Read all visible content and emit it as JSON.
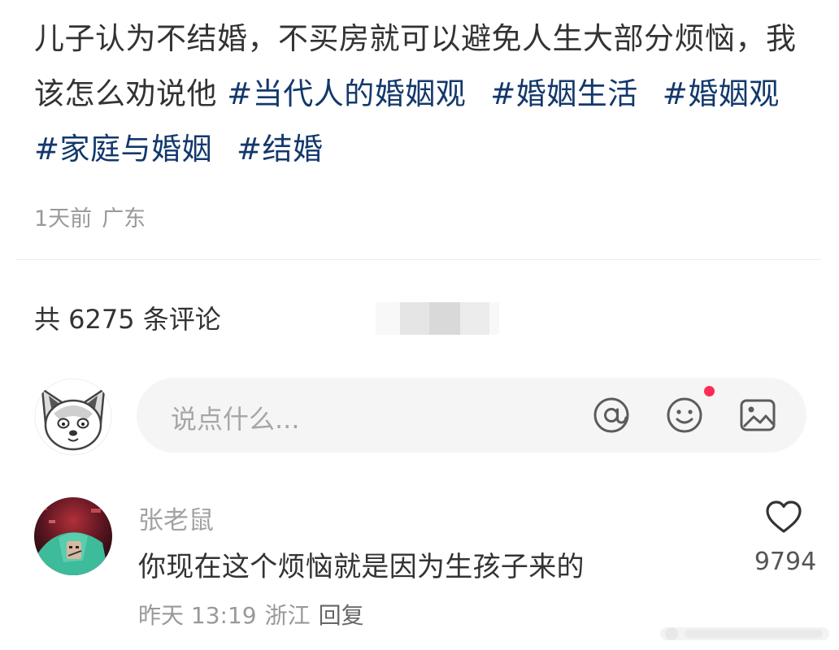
{
  "post": {
    "text": "儿子认为不结婚，不买房就可以避免人生大部分烦恼，我该怎么劝说他",
    "hashtags": [
      "#当代人的婚姻观",
      "#婚姻生活",
      "#婚姻观",
      "#家庭与婚姻",
      "#结婚"
    ],
    "time": "1天前",
    "location": "广东"
  },
  "comments_section": {
    "count_label": "共 6275 条评论"
  },
  "input": {
    "placeholder": "说点什么...",
    "icons": [
      "at-icon",
      "emoji-icon",
      "image-icon"
    ]
  },
  "comment": {
    "username": "张老鼠",
    "content": "你现在这个烦恼就是因为生孩子来的",
    "time": "昨天 13:19",
    "location": "浙江",
    "reply_label": "回复",
    "likes": "9794"
  },
  "colors": {
    "hashtag": "#13386c",
    "text": "#333333",
    "muted": "#999999",
    "input_bg": "#f5f5f5",
    "notification_dot": "#fe2c55"
  }
}
